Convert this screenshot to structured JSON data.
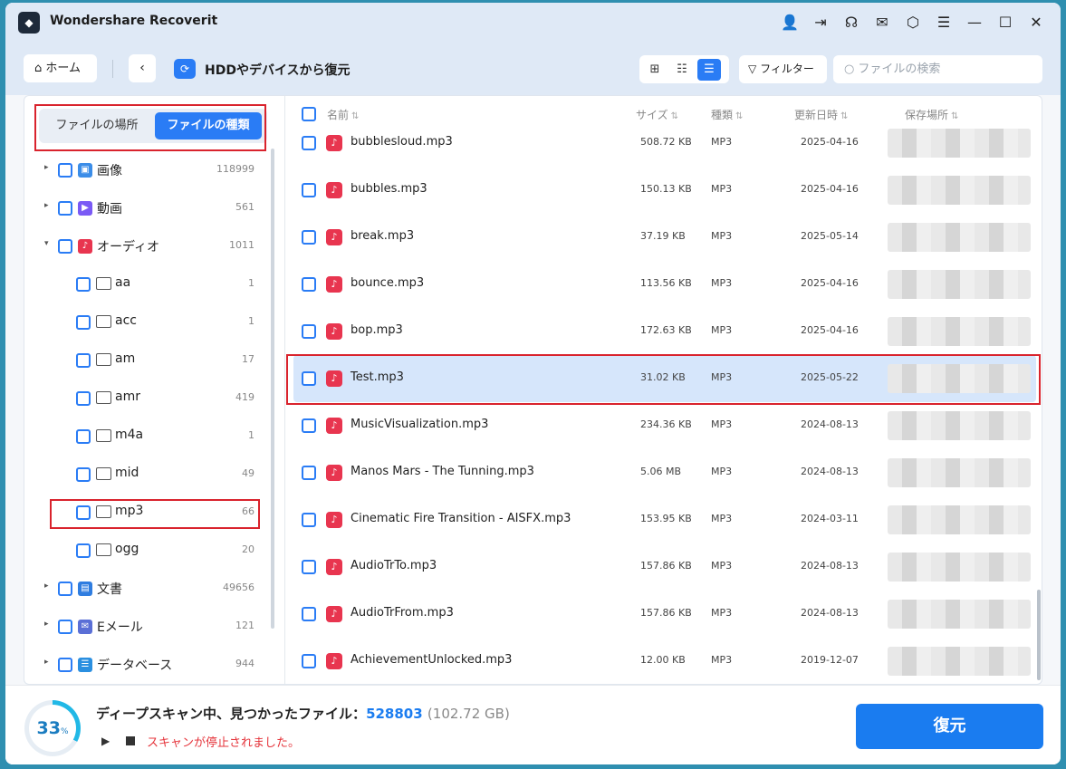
{
  "app": {
    "title": "Wondershare Recoverit",
    "logo": "recoverit-logo"
  },
  "titlebar_icons": [
    "user-icon",
    "export-icon",
    "headset-icon",
    "mail-icon",
    "cube-icon",
    "menu-icon",
    "minimize-icon",
    "maximize-icon",
    "close-icon"
  ],
  "toolbar": {
    "home_label": "ホーム",
    "page_title": "HDDやデバイスから復元",
    "filter_label": "フィルター",
    "search_placeholder": "ファイルの検索"
  },
  "sidebar": {
    "tabs": [
      "ファイルの場所",
      "ファイルの種類"
    ],
    "active_tab": 1,
    "tree": [
      {
        "label": "画像",
        "count": "118999",
        "level": 0,
        "expand": "collapsed",
        "icon": "image-icon",
        "color": "#3b8de8"
      },
      {
        "label": "動画",
        "count": "561",
        "level": 0,
        "expand": "collapsed",
        "icon": "video-icon",
        "color": "#7a5af5"
      },
      {
        "label": "オーディオ",
        "count": "1011",
        "level": 0,
        "expand": "expanded",
        "icon": "audio-icon",
        "color": "#e8354f"
      },
      {
        "label": "aa",
        "count": "1",
        "level": 1
      },
      {
        "label": "acc",
        "count": "1",
        "level": 1
      },
      {
        "label": "am",
        "count": "17",
        "level": 1
      },
      {
        "label": "amr",
        "count": "419",
        "level": 1
      },
      {
        "label": "m4a",
        "count": "1",
        "level": 1
      },
      {
        "label": "mid",
        "count": "49",
        "level": 1
      },
      {
        "label": "mp3",
        "count": "66",
        "level": 1
      },
      {
        "label": "ogg",
        "count": "20",
        "level": 1
      },
      {
        "label": "文書",
        "count": "49656",
        "level": 0,
        "expand": "collapsed",
        "icon": "document-icon",
        "color": "#2f7de0"
      },
      {
        "label": "Eメール",
        "count": "121",
        "level": 0,
        "expand": "collapsed",
        "icon": "email-icon",
        "color": "#5a6fd6"
      },
      {
        "label": "データベース",
        "count": "944",
        "level": 0,
        "expand": "collapsed",
        "icon": "database-icon",
        "color": "#2a8fe0"
      }
    ]
  },
  "list": {
    "columns": [
      "名前",
      "サイズ",
      "種類",
      "更新日時",
      "保存場所"
    ],
    "sort_icon": "⇅",
    "rows": [
      {
        "name": "bubblesloud.mp3",
        "size": "508.72 KB",
        "type": "MP3",
        "date": "2025-04-16"
      },
      {
        "name": "bubbles.mp3",
        "size": "150.13 KB",
        "type": "MP3",
        "date": "2025-04-16"
      },
      {
        "name": "break.mp3",
        "size": "37.19 KB",
        "type": "MP3",
        "date": "2025-05-14"
      },
      {
        "name": "bounce.mp3",
        "size": "113.56 KB",
        "type": "MP3",
        "date": "2025-04-16"
      },
      {
        "name": "bop.mp3",
        "size": "172.63 KB",
        "type": "MP3",
        "date": "2025-04-16"
      },
      {
        "name": "Test.mp3",
        "size": "31.02 KB",
        "type": "MP3",
        "date": "2025-05-22",
        "selected": true
      },
      {
        "name": "MusicVisualization.mp3",
        "size": "234.36 KB",
        "type": "MP3",
        "date": "2024-08-13"
      },
      {
        "name": "Manos Mars - The Tunning.mp3",
        "size": "5.06 MB",
        "type": "MP3",
        "date": "2024-08-13"
      },
      {
        "name": "Cinematic Fire Transition - AISFX.mp3",
        "size": "153.95 KB",
        "type": "MP3",
        "date": "2024-03-11"
      },
      {
        "name": "AudioTrTo.mp3",
        "size": "157.86 KB",
        "type": "MP3",
        "date": "2024-08-13"
      },
      {
        "name": "AudioTrFrom.mp3",
        "size": "157.86 KB",
        "type": "MP3",
        "date": "2024-08-13"
      },
      {
        "name": "AchievementUnlocked.mp3",
        "size": "12.00 KB",
        "type": "MP3",
        "date": "2019-12-07"
      }
    ]
  },
  "footer": {
    "progress": "33",
    "progress_unit": "%",
    "status_prefix": "ディープスキャン中、見つかったファイル：",
    "found_count": "528803",
    "found_size": "(102.72 GB)",
    "stop_message": "スキャンが停止されました。",
    "recover_label": "復元"
  }
}
